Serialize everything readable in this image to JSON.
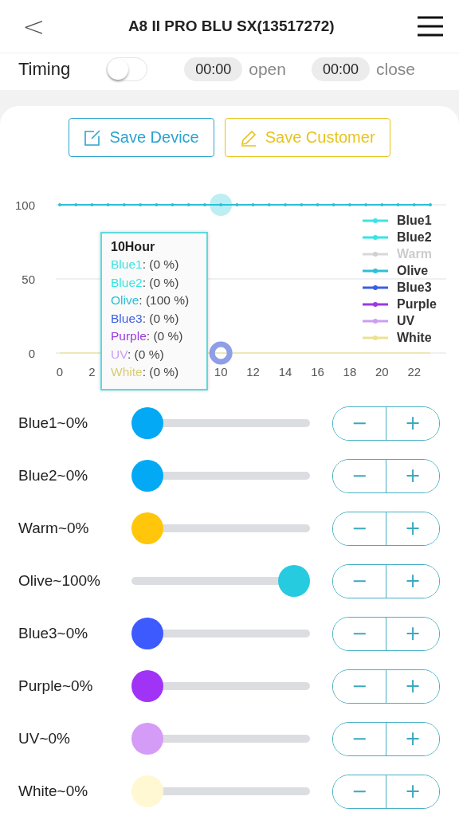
{
  "header": {
    "back": "<",
    "title": "A8 II PRO BLU SX(13517272)"
  },
  "timing": {
    "label": "Timing",
    "on": false,
    "open_time": "00:00",
    "open_label": "open",
    "close_time": "00:00",
    "close_label": "close"
  },
  "buttons": [
    {
      "kind": "device",
      "label": "Save Device"
    },
    {
      "kind": "customer",
      "label": "Save Customer"
    }
  ],
  "chart": {
    "y_labels": [
      "100",
      "50",
      "0"
    ],
    "x_labels": [
      "0",
      "2",
      "10",
      "12",
      "14",
      "16",
      "18",
      "20",
      "22"
    ],
    "legend": [
      {
        "name": "Blue1",
        "color": "#3ee3e3",
        "enabled": true
      },
      {
        "name": "Blue2",
        "color": "#33e6e6",
        "enabled": true
      },
      {
        "name": "Warm",
        "color": "#cfcfcf",
        "enabled": false
      },
      {
        "name": "Olive",
        "color": "#2cc0d4",
        "enabled": true
      },
      {
        "name": "Blue3",
        "color": "#3b5ee6",
        "enabled": true
      },
      {
        "name": "Purple",
        "color": "#9b3be0",
        "enabled": true
      },
      {
        "name": "UV",
        "color": "#cc9ef2",
        "enabled": true
      },
      {
        "name": "White",
        "color": "#ece28c",
        "enabled": true
      }
    ],
    "tooltip": {
      "title": "10Hour",
      "rows": [
        {
          "name": "Blue1",
          "value": ": (0 %)",
          "color": "#3ee3e3"
        },
        {
          "name": "Blue2",
          "value": ": (0 %)",
          "color": "#33e6e6"
        },
        {
          "name": "Olive",
          "value": ": (100 %)",
          "color": "#2cc0d4"
        },
        {
          "name": "Blue3",
          "value": ": (0 %)",
          "color": "#3b5ee6"
        },
        {
          "name": "Purple",
          "value": ": (0 %)",
          "color": "#9b3be0"
        },
        {
          "name": "UV",
          "value": ": (0 %)",
          "color": "#cc9ef2"
        },
        {
          "name": "White",
          "value": ": (0 %)",
          "color": "#d8cc70"
        }
      ]
    }
  },
  "channels": [
    {
      "label": "Blue1~0%",
      "level": 0,
      "color": "#03a9f4",
      "minus": "−",
      "plus": "+"
    },
    {
      "label": "Blue2~0%",
      "level": 0,
      "color": "#03a9f4",
      "minus": "−",
      "plus": "+"
    },
    {
      "label": "Warm~0%",
      "level": 0,
      "color": "#ffc60b",
      "minus": "−",
      "plus": "+"
    },
    {
      "label": "Olive~100%",
      "level": 1,
      "color": "#26cbe0",
      "minus": "−",
      "plus": "+"
    },
    {
      "label": "Blue3~0%",
      "level": 0,
      "color": "#3d5afe",
      "minus": "−",
      "plus": "+"
    },
    {
      "label": "Purple~0%",
      "level": 0,
      "color": "#a033f5",
      "minus": "−",
      "plus": "+"
    },
    {
      "label": "UV~0%",
      "level": 0,
      "color": "#d59cf7",
      "minus": "−",
      "plus": "+"
    },
    {
      "label": "White~0%",
      "level": 0,
      "color": "#fff8d2",
      "minus": "−",
      "plus": "+"
    }
  ]
}
